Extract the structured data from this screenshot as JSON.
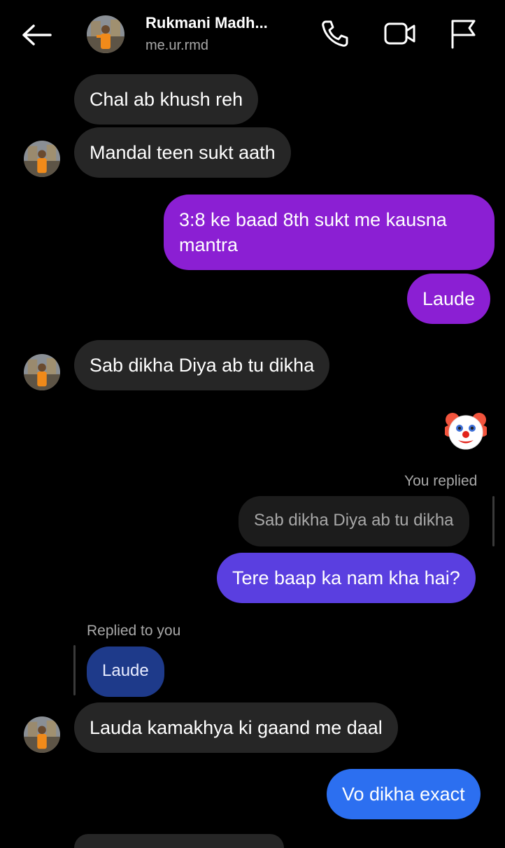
{
  "header": {
    "contact_name": "Rukmani Madh...",
    "contact_handle": "me.ur.rmd"
  },
  "icons": {
    "back": "back-arrow-icon",
    "call": "phone-icon",
    "video": "video-camera-icon",
    "report": "flag-icon"
  },
  "colors": {
    "background": "#000000",
    "received_bubble": "#262626",
    "sent_purple": "#8b1fd3",
    "sent_indigo": "#5a3fe0",
    "sent_blue": "#2c6ff0",
    "quoted_reply_blue": "#1e3a8a"
  },
  "messages": [
    {
      "from": "them",
      "text": "Chal ab khush reh"
    },
    {
      "from": "them",
      "text": "Mandal teen sukt aath"
    },
    {
      "from": "me",
      "text": "3:8 ke baad 8th sukt me kausna mantra",
      "line1": "3:8 ke baad 8th sukt me kausna",
      "line2": "mantra"
    },
    {
      "from": "me",
      "text": "Laude"
    },
    {
      "from": "them",
      "text": "Sab dikha Diya ab tu dikha"
    },
    {
      "from": "me",
      "emoji": "🤡"
    },
    {
      "from": "me",
      "reply_label": "You replied",
      "quoted": "Sab dikha Diya ab tu dikha",
      "text": "Tere baap ka nam kha hai?"
    },
    {
      "from": "them",
      "reply_label": "Replied to you",
      "quoted": "Laude",
      "text": "Lauda kamakhya ki gaand me daal"
    },
    {
      "from": "me",
      "text": "Vo dikha exact"
    }
  ]
}
